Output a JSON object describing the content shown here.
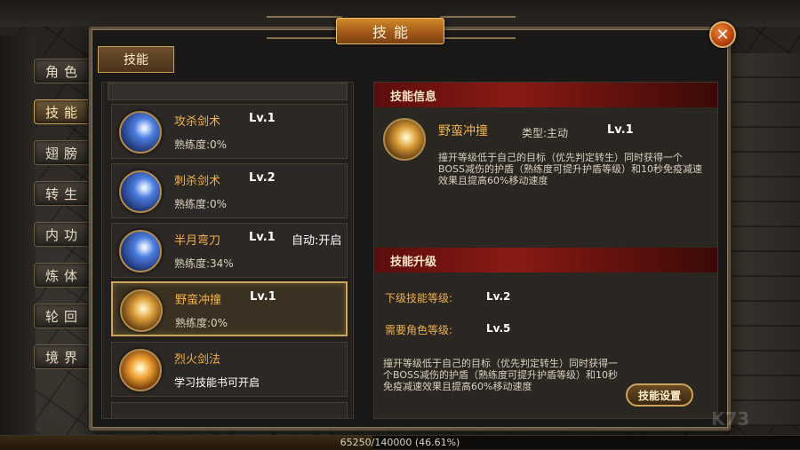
{
  "window": {
    "title": "技能",
    "close_symbol": "✕"
  },
  "side_tabs": [
    {
      "label": "角色",
      "active": false
    },
    {
      "label": "技能",
      "active": true
    },
    {
      "label": "翅膀",
      "active": false
    },
    {
      "label": "转生",
      "active": false
    },
    {
      "label": "内功",
      "active": false
    },
    {
      "label": "炼体",
      "active": false
    },
    {
      "label": "轮回",
      "active": false
    },
    {
      "label": "境界",
      "active": false
    }
  ],
  "skills_tab_label": "技能",
  "skills": [
    {
      "name": "攻杀剑术",
      "level": "Lv.1",
      "auto": "",
      "proficiency": "熟练度:0%",
      "icon": "slash-blue-icon",
      "selected": false
    },
    {
      "name": "刺杀剑术",
      "level": "Lv.2",
      "auto": "",
      "proficiency": "熟练度:0%",
      "icon": "thrust-blue-icon",
      "selected": false
    },
    {
      "name": "半月弯刀",
      "level": "Lv.1",
      "auto": "自动:开启",
      "proficiency": "熟练度:34%",
      "icon": "crescent-blue-icon",
      "selected": false
    },
    {
      "name": "野蛮冲撞",
      "level": "Lv.1",
      "auto": "",
      "proficiency": "熟练度:0%",
      "icon": "charge-gold-icon",
      "selected": true
    },
    {
      "name": "烈火剑法",
      "level": "",
      "auto": "",
      "proficiency": "学习技能书可开启",
      "icon": "fire-sword-icon",
      "selected": false
    }
  ],
  "info": {
    "header": "技能信息",
    "name": "野蛮冲撞",
    "type": "类型:主动",
    "level": "Lv.1",
    "description": "撞开等级低于自己的目标（优先判定转生）同时获得一个BOSS减伤的护盾（熟练度可提升护盾等级）和10秒免疫减速效果且提高60%移动速度"
  },
  "upgrade": {
    "header": "技能升级",
    "next_level_label": "下级技能等级:",
    "next_level_value": "Lv.2",
    "required_level_label": "需要角色等级:",
    "required_level_value": "Lv.5",
    "description": "撞开等级低于自己的目标（优先判定转生）同时获得一个BOSS减伤的护盾（熟练度可提升护盾等级）和10秒免疫减速效果且提高60%移动速度",
    "settings_button": "技能设置"
  },
  "exp": {
    "text": "65250/140000 (46.61%)",
    "fraction": 0.4661
  }
}
